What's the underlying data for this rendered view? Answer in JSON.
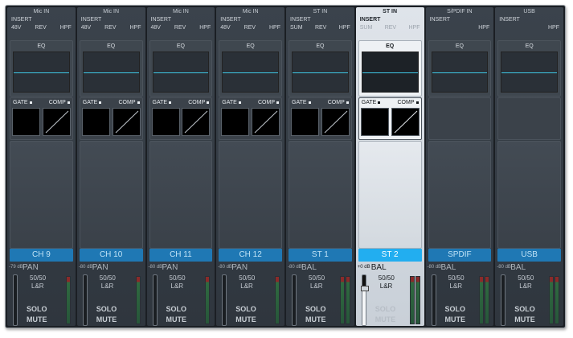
{
  "strips": [
    {
      "source": "Mic IN",
      "insert": "INSERT",
      "flags": [
        "48V",
        "REV",
        "HPF"
      ],
      "eq_label": "EQ",
      "gate_label": "GATE",
      "comp_label": "COMP",
      "has_dyn": true,
      "name": "CH 9",
      "level_db": "-79 dB",
      "mode": "PAN",
      "ratio": "50/50",
      "route": "L&R",
      "solo": "SOLO",
      "mute": "MUTE",
      "meters": 1,
      "selected": false,
      "fader_level": 0
    },
    {
      "source": "Mic IN",
      "insert": "INSERT",
      "flags": [
        "48V",
        "REV",
        "HPF"
      ],
      "eq_label": "EQ",
      "gate_label": "GATE",
      "comp_label": "COMP",
      "has_dyn": true,
      "name": "CH 10",
      "level_db": "-80 dB",
      "mode": "PAN",
      "ratio": "50/50",
      "route": "L&R",
      "solo": "SOLO",
      "mute": "MUTE",
      "meters": 1,
      "selected": false,
      "fader_level": 0
    },
    {
      "source": "Mic IN",
      "insert": "INSERT",
      "flags": [
        "48V",
        "REV",
        "HPF"
      ],
      "eq_label": "EQ",
      "gate_label": "GATE",
      "comp_label": "COMP",
      "has_dyn": true,
      "name": "CH 11",
      "level_db": "-80 dB",
      "mode": "PAN",
      "ratio": "50/50",
      "route": "L&R",
      "solo": "SOLO",
      "mute": "MUTE",
      "meters": 1,
      "selected": false,
      "fader_level": 0
    },
    {
      "source": "Mic IN",
      "insert": "INSERT",
      "flags": [
        "48V",
        "REV",
        "HPF"
      ],
      "eq_label": "EQ",
      "gate_label": "GATE",
      "comp_label": "COMP",
      "has_dyn": true,
      "name": "CH 12",
      "level_db": "-80 dB",
      "mode": "PAN",
      "ratio": "50/50",
      "route": "L&R",
      "solo": "SOLO",
      "mute": "MUTE",
      "meters": 1,
      "selected": false,
      "fader_level": 0
    },
    {
      "source": "ST IN",
      "insert": "INSERT",
      "flags": [
        "SUM",
        "REV",
        "HPF"
      ],
      "eq_label": "EQ",
      "gate_label": "GATE",
      "comp_label": "COMP",
      "has_dyn": true,
      "name": "ST 1",
      "level_db": "-80 dB",
      "mode": "BAL",
      "ratio": "50/50",
      "route": "L&R",
      "solo": "SOLO",
      "mute": "MUTE",
      "meters": 2,
      "selected": false,
      "fader_level": 0
    },
    {
      "source": "ST IN",
      "insert": "INSERT",
      "flags": [
        "SUM",
        "REV",
        "HPF"
      ],
      "eq_label": "EQ",
      "gate_label": "GATE",
      "comp_label": "COMP",
      "has_dyn": true,
      "name": "ST 2",
      "level_db": "+0 dB",
      "mode": "BAL",
      "ratio": "50/50",
      "route": "L&R",
      "solo": "SOLO",
      "mute": "MUTE",
      "meters": 2,
      "selected": true,
      "fader_level": 0.75
    },
    {
      "source": "S/PDIF IN",
      "insert": "INSERT",
      "flags": [
        "",
        "",
        "HPF"
      ],
      "eq_label": "EQ",
      "gate_label": "",
      "comp_label": "",
      "has_dyn": false,
      "name": "SPDIF",
      "level_db": "-80 dB",
      "mode": "BAL",
      "ratio": "50/50",
      "route": "L&R",
      "solo": "SOLO",
      "mute": "MUTE",
      "meters": 2,
      "selected": false,
      "fader_level": 0
    },
    {
      "source": "USB",
      "insert": "INSERT",
      "flags": [
        "",
        "",
        "HPF"
      ],
      "eq_label": "EQ",
      "gate_label": "",
      "comp_label": "",
      "has_dyn": false,
      "name": "USB",
      "level_db": "-80 dB",
      "mode": "BAL",
      "ratio": "50/50",
      "route": "L&R",
      "solo": "SOLO",
      "mute": "MUTE",
      "meters": 2,
      "selected": false,
      "fader_level": 0
    }
  ],
  "colors": {
    "accent": "#1f78b4",
    "selected_accent": "#22aef0",
    "eq_curve": "#3fc8e6"
  }
}
